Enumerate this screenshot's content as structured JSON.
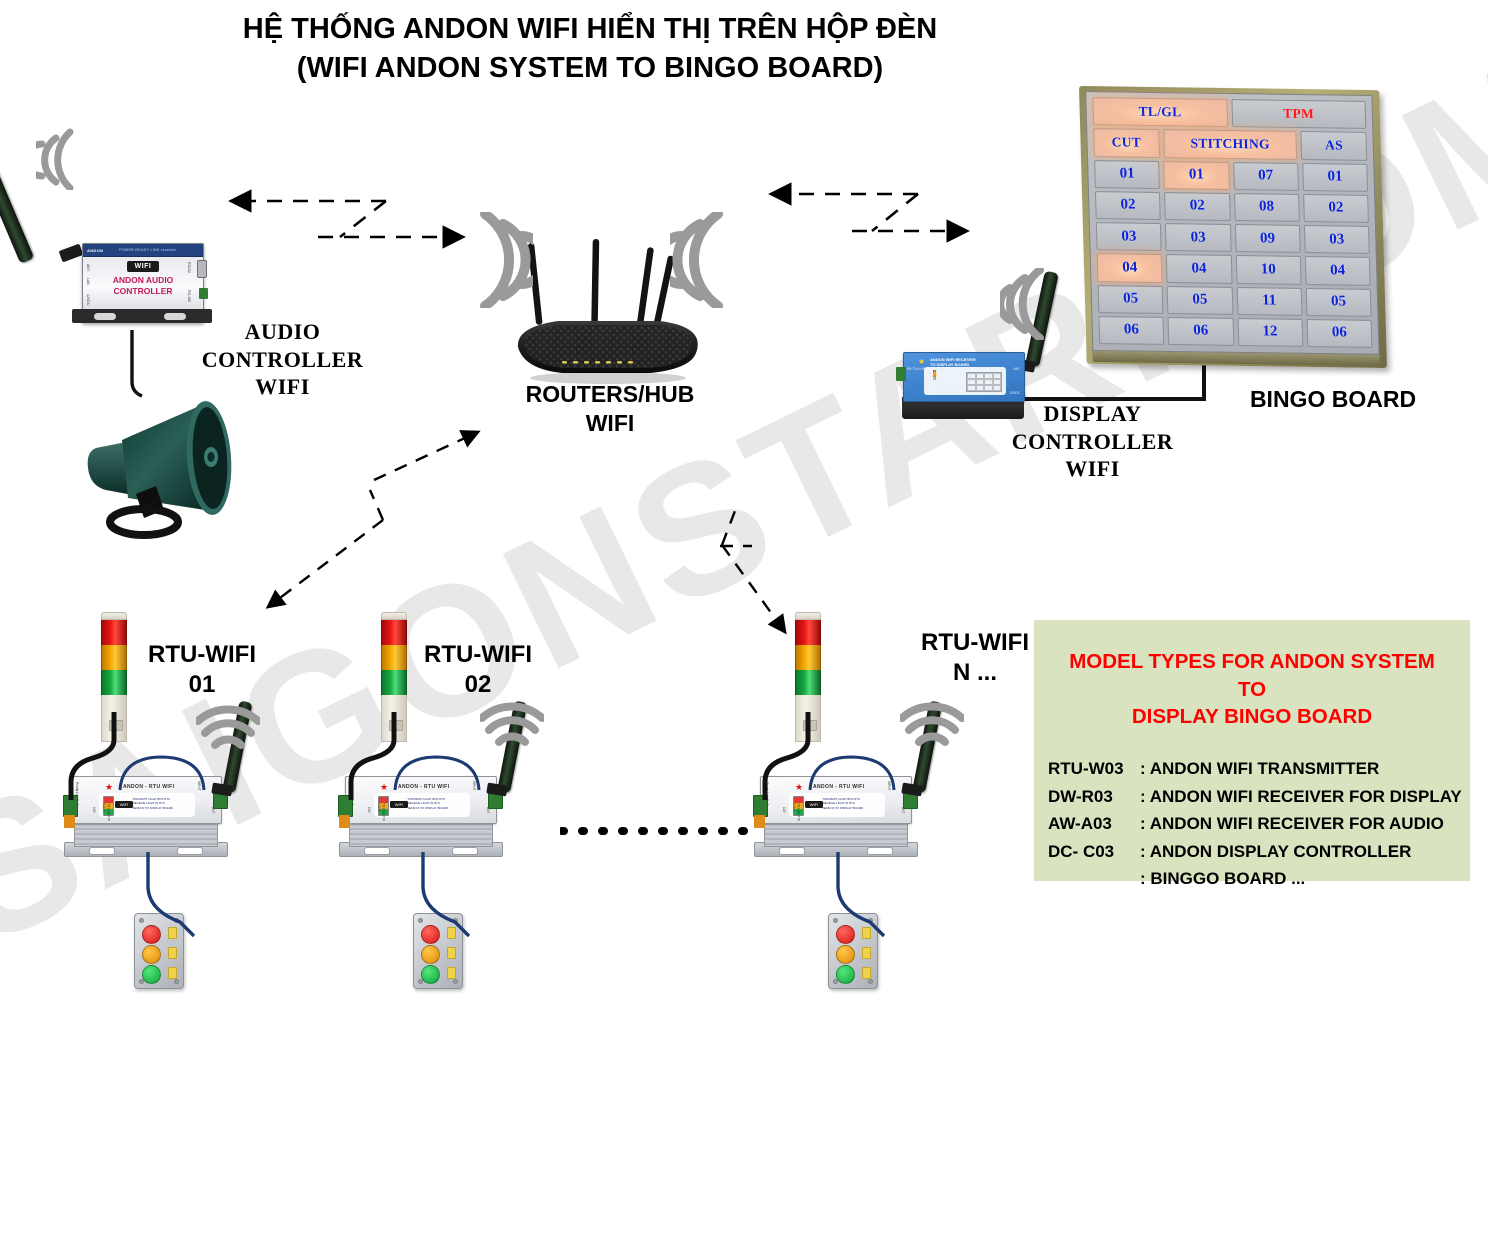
{
  "title": {
    "line1": "HỆ THỐNG ANDON WIFI HIỂN THỊ TRÊN HỘP ĐÈN",
    "line2": "(WIFI ANDON SYSTEM TO BINGO BOARD)"
  },
  "watermark": {
    "text": "SAIGONSTAR.COM"
  },
  "devices": {
    "audio_controller": {
      "label_line1": "AUDIO",
      "label_line2": "CONTROLLER WIFI",
      "face_brand": "ANDON",
      "face_strip": "POWER READY LINK receiver",
      "face_wifi": "WIFI",
      "face_text_line1": "ANDON AUDIO",
      "face_text_line2": "CONTROLLER",
      "port_lan": "LAN",
      "port_ant": "ANT",
      "port_power": "12VDC",
      "port_rs232": "RS232",
      "port_rs485": "RS-485"
    },
    "router": {
      "label_line1": "ROUTERS/HUB",
      "label_line2": "WIFI"
    },
    "display_controller": {
      "label_line1": "DISPLAY",
      "label_line2": "CONTROLLER WIFI",
      "face_line1": "ANDON WIFI RECEIVER",
      "face_line2": "TO DISPLAY BOARD",
      "port_ant": "ANT",
      "port_power": "12VDC",
      "port_io": "RX TX A+ B- Ready"
    },
    "bingo_board": {
      "label": "BINGO BOARD"
    }
  },
  "stations": [
    {
      "label_line1": "RTU-WIFI",
      "label_line2": "01",
      "box_name": "ANDON - RTU WIFI",
      "panel_line1": "TRANSMIT LIGHT BOX RTU",
      "panel_line2": "RECEIVE LIGHT IN RTU",
      "panel_line3": "SEND ID TO DISPLAY BOARD",
      "panel_wifi": "WIFI",
      "side_ready": "Ready  Link  Rx  Tx",
      "side_io": "TO LIGHT  R  Y  G  N",
      "side_pwr": "12V",
      "side_ant": "ANT",
      "side_in": "INPUT"
    },
    {
      "label_line1": "RTU-WIFI",
      "label_line2": "02",
      "box_name": "ANDON - RTU WIFI",
      "panel_line1": "TRANSMIT LIGHT BOX RTU",
      "panel_line2": "RECEIVE LIGHT IN RTU",
      "panel_line3": "SEND ID TO DISPLAY BOARD",
      "panel_wifi": "WIFI",
      "side_ready": "Ready  Link  Rx  Tx",
      "side_io": "TO LIGHT  R  Y  G  N",
      "side_pwr": "12V",
      "side_ant": "ANT",
      "side_in": "INPUT"
    },
    {
      "label_line1": "RTU-WIFI",
      "label_line2": "N ...",
      "box_name": "ANDON - RTU WIFI",
      "panel_line1": "TRANSMIT LIGHT BOX RTU",
      "panel_line2": "RECEIVE LIGHT IN RTU",
      "panel_line3": "SEND ID TO DISPLAY BOARD",
      "panel_wifi": "WIFI",
      "side_ready": "Ready  Link  Rx  Tx",
      "side_io": "TO LIGHT  R  Y  G  N",
      "side_pwr": "12V",
      "side_ant": "ANT",
      "side_in": "INPUT"
    }
  ],
  "bingo_board_data": {
    "type": "table",
    "header_row": [
      {
        "text": "TL/GL",
        "span": 2,
        "color": "#0b22d8",
        "lit": true
      },
      {
        "text": "TPM",
        "span": 2,
        "color": "#ff1212",
        "lit": false
      }
    ],
    "column_headers": [
      {
        "text": "CUT",
        "span": 1,
        "lit": true
      },
      {
        "text": "STITCHING",
        "span": 2,
        "lit": true
      },
      {
        "text": "AS",
        "span": 1,
        "lit": false
      }
    ],
    "rows": [
      [
        {
          "text": "01",
          "lit": false
        },
        {
          "text": "01",
          "lit": true
        },
        {
          "text": "07",
          "lit": false
        },
        {
          "text": "01",
          "lit": false
        }
      ],
      [
        {
          "text": "02",
          "lit": false
        },
        {
          "text": "02",
          "lit": false
        },
        {
          "text": "08",
          "lit": false
        },
        {
          "text": "02",
          "lit": false
        }
      ],
      [
        {
          "text": "03",
          "lit": false
        },
        {
          "text": "03",
          "lit": false
        },
        {
          "text": "09",
          "lit": false
        },
        {
          "text": "03",
          "lit": false
        }
      ],
      [
        {
          "text": "04",
          "lit": true
        },
        {
          "text": "04",
          "lit": false
        },
        {
          "text": "10",
          "lit": false
        },
        {
          "text": "04",
          "lit": false
        }
      ],
      [
        {
          "text": "05",
          "lit": false
        },
        {
          "text": "05",
          "lit": false
        },
        {
          "text": "11",
          "lit": false
        },
        {
          "text": "05",
          "lit": false
        }
      ],
      [
        {
          "text": "06",
          "lit": false
        },
        {
          "text": "06",
          "lit": false
        },
        {
          "text": "12",
          "lit": false
        },
        {
          "text": "06",
          "lit": false
        }
      ]
    ],
    "colors": {
      "number": "#0b22d8",
      "tpm": "#ff1212",
      "lit_glow": "#ffd0a8"
    }
  },
  "legend": {
    "title_line1": "MODEL TYPES FOR ANDON SYSTEM TO",
    "title_line2": "DISPLAY BINGO BOARD",
    "title_color": "#ff0000",
    "background_color": "#d9e3c0",
    "items": [
      {
        "code": "RTU-W03",
        "desc": ": ANDON WIFI TRANSMITTER"
      },
      {
        "code": "DW-R03",
        "desc": ": ANDON WIFI RECEIVER FOR DISPLAY"
      },
      {
        "code": "AW-A03",
        "desc": ": ANDON WIFI RECEIVER FOR AUDIO"
      },
      {
        "code": "DC- C03",
        "desc": ": ANDON DISPLAY CONTROLLER"
      },
      {
        "code": "",
        "desc": ": BINGGO BOARD ..."
      }
    ]
  }
}
